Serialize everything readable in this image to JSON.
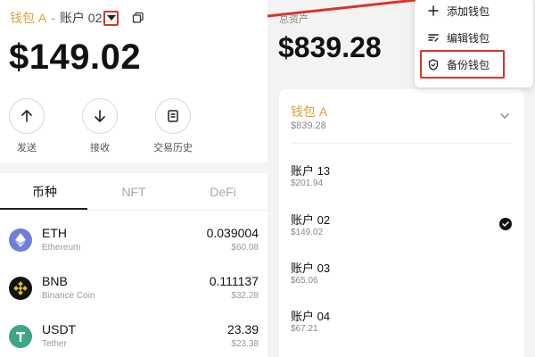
{
  "header": {
    "wallet_name": "钱包 A",
    "separator": "-",
    "account_name": "账户 02"
  },
  "balance": "$149.02",
  "actions": [
    {
      "label": "发送",
      "icon": "arrow-up-icon"
    },
    {
      "label": "接收",
      "icon": "arrow-down-icon"
    },
    {
      "label": "交易历史",
      "icon": "history-icon"
    }
  ],
  "tabs": [
    {
      "label": "币种",
      "active": true
    },
    {
      "label": "NFT",
      "active": false
    },
    {
      "label": "DeFi",
      "active": false
    }
  ],
  "tokens": [
    {
      "symbol": "ETH",
      "name": "Ethereum",
      "amount": "0.039004",
      "value": "$60.08",
      "color": "#6f7fd8"
    },
    {
      "symbol": "BNB",
      "name": "Binance Coin",
      "amount": "0.111137",
      "value": "$32.28",
      "color": "#111111"
    },
    {
      "symbol": "USDT",
      "name": "Tether",
      "amount": "23.39",
      "value": "$23.38",
      "color": "#3fa587"
    }
  ],
  "total": {
    "label": "总资产",
    "value": "$839.28"
  },
  "wallet_card": {
    "name": "钱包 A",
    "total": "$839.28",
    "accounts": [
      {
        "name": "账户 13",
        "value": "$201.94",
        "selected": false
      },
      {
        "name": "账户 02",
        "value": "$149.02",
        "selected": true
      },
      {
        "name": "账户 03",
        "value": "$65.06",
        "selected": false
      },
      {
        "name": "账户 04",
        "value": "$67.21",
        "selected": false
      }
    ]
  },
  "menu": {
    "items": [
      {
        "label": "添加钱包",
        "icon": "plus-icon"
      },
      {
        "label": "编辑钱包",
        "icon": "edit-icon"
      },
      {
        "label": "备份钱包",
        "icon": "shield-icon"
      }
    ]
  },
  "colors": {
    "accent": "#e0a13b",
    "highlight": "#d9342b"
  }
}
